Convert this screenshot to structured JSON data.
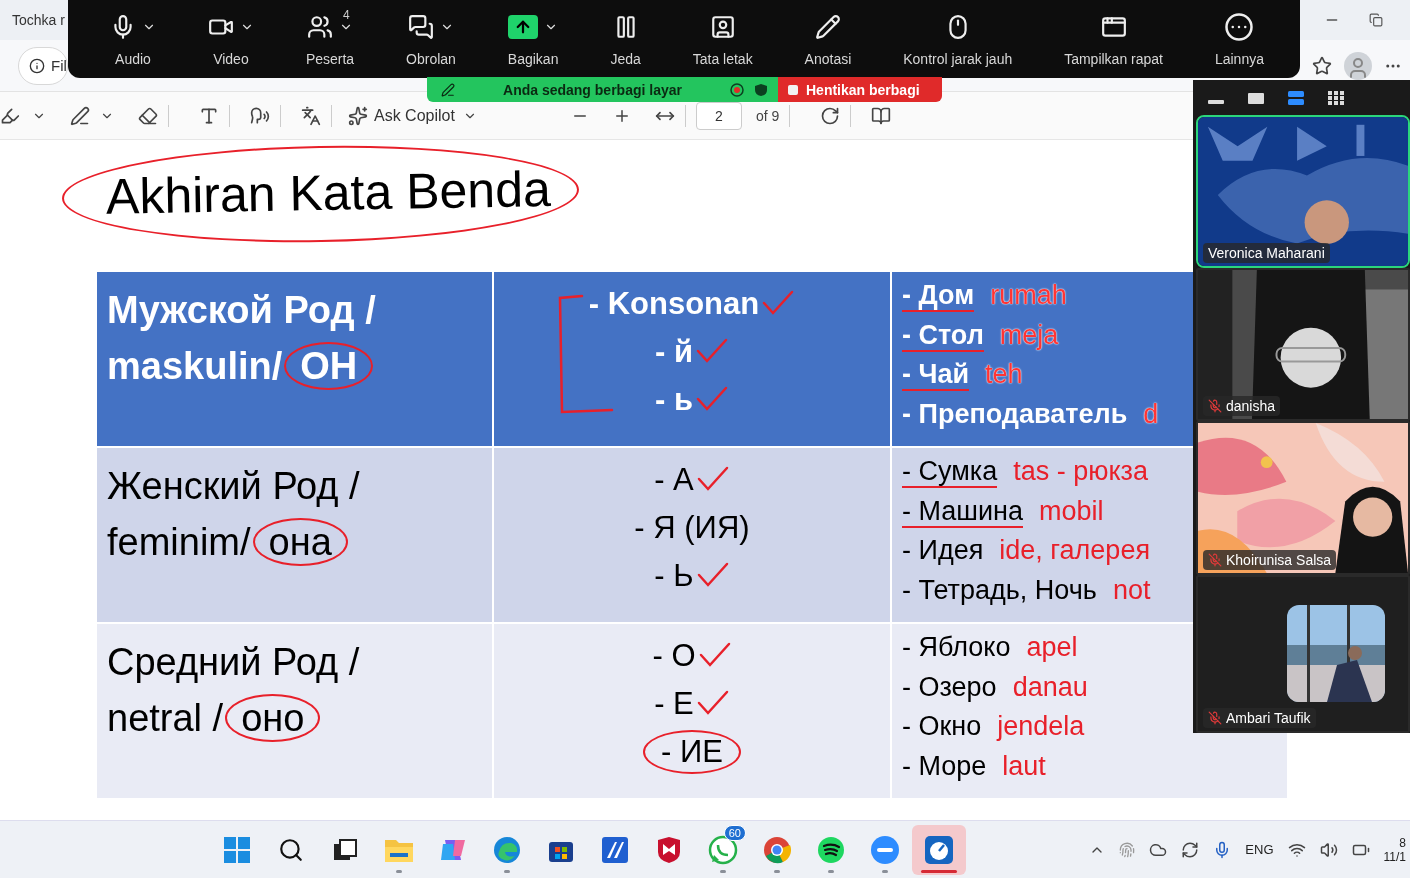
{
  "browser": {
    "tab_title": "Tochka r",
    "address_text": "Fil"
  },
  "zoom_toolbar": {
    "participant_count": "4",
    "items": [
      {
        "label": "Audio",
        "caret": true
      },
      {
        "label": "Video",
        "caret": true
      },
      {
        "label": "Peserta",
        "caret": true
      },
      {
        "label": "Obrolan",
        "caret": true
      },
      {
        "label": "Bagikan",
        "caret": true
      },
      {
        "label": "Jeda",
        "caret": false
      },
      {
        "label": "Tata letak",
        "caret": false
      },
      {
        "label": "Anotasi",
        "caret": false
      },
      {
        "label": "Kontrol jarak jauh",
        "caret": false
      },
      {
        "label": "Tampilkan rapat",
        "caret": false
      },
      {
        "label": "Lainnya",
        "caret": false
      }
    ]
  },
  "share_banner": {
    "message": "Anda sedang berbagi layar",
    "stop_label": "Hentikan berbagi"
  },
  "pdf_toolbar": {
    "copilot_label": "Ask Copilot",
    "page": "2",
    "page_total": "of 9"
  },
  "slide": {
    "title": "Akhiran Kata Benda",
    "rows": [
      {
        "header": true,
        "gender": "Мужской Род /",
        "gender_label": "maskulin/",
        "pronoun": "ОН",
        "bracketed": true,
        "endings": [
          {
            "text": "- Konsonan",
            "ticked": true,
            "circled": false
          },
          {
            "text": "- й",
            "ticked": true,
            "circled": false
          },
          {
            "text": "- ь",
            "ticked": true,
            "circled": false
          }
        ],
        "words": [
          {
            "word": "- Дом",
            "underlined": true,
            "note": "rumah"
          },
          {
            "word": "- Стол",
            "underlined": true,
            "note": "meja"
          },
          {
            "word": "- Чай",
            "underlined": true,
            "note": "teh"
          },
          {
            "word": "- Преподаватель",
            "underlined": false,
            "note": "d"
          }
        ]
      },
      {
        "header": false,
        "gender": "Женский Род /",
        "gender_label": "feminim/",
        "pronoun": "она",
        "bracketed": false,
        "endings": [
          {
            "text": "- А",
            "ticked": true,
            "circled": false
          },
          {
            "text": "- Я (ИЯ)",
            "ticked": false,
            "circled": false
          },
          {
            "text": "- Ь",
            "ticked": true,
            "circled": false
          }
        ],
        "words": [
          {
            "word": "- Сумка",
            "underlined": true,
            "note": "tas - рюкза"
          },
          {
            "word": "- Машина",
            "underlined": true,
            "note": "mobil"
          },
          {
            "word": "- Идея",
            "underlined": false,
            "note": "ide, галерея"
          },
          {
            "word": "- Тетрадь, Ночь",
            "underlined": false,
            "note": "not"
          }
        ]
      },
      {
        "header": false,
        "gender": "Средний Род /",
        "gender_label": "netral /",
        "pronoun": "оно",
        "bracketed": false,
        "endings": [
          {
            "text": "- О",
            "ticked": true,
            "circled": false
          },
          {
            "text": "- Е",
            "ticked": true,
            "circled": false
          },
          {
            "text": "- ИЕ",
            "ticked": false,
            "circled": true
          }
        ],
        "words": [
          {
            "word": "- Яблоко",
            "underlined": false,
            "note": "apel"
          },
          {
            "word": "- Озеро",
            "underlined": false,
            "note": "danau"
          },
          {
            "word": "- Окно",
            "underlined": false,
            "note": "jendela"
          },
          {
            "word": "- Море",
            "underlined": false,
            "note": "laut"
          }
        ]
      }
    ]
  },
  "participants": {
    "view_modes": [
      {
        "selected": false
      },
      {
        "selected": false
      },
      {
        "selected": true
      },
      {
        "selected": false
      }
    ],
    "tiles": [
      {
        "name": "Veronica Maharani",
        "active_speaker": true,
        "muted": false
      },
      {
        "name": "danisha",
        "active_speaker": false,
        "muted": true
      },
      {
        "name": "Khoirunisa Salsa",
        "active_speaker": false,
        "muted": true
      },
      {
        "name": "Ambari Taufik",
        "active_speaker": false,
        "muted": true
      }
    ]
  },
  "taskbar": {
    "apps": [
      {
        "active": false,
        "running": false
      },
      {
        "active": false,
        "running": false
      },
      {
        "active": false,
        "running": false
      },
      {
        "active": false,
        "running": true
      },
      {
        "active": false,
        "running": false
      },
      {
        "active": false,
        "running": true
      },
      {
        "active": false,
        "running": false
      },
      {
        "active": false,
        "running": false
      },
      {
        "active": false,
        "running": false
      },
      {
        "active": false,
        "running": true,
        "badge": "60"
      },
      {
        "active": false,
        "running": true
      },
      {
        "active": false,
        "running": true
      },
      {
        "active": false,
        "running": true
      },
      {
        "active": true,
        "running": true
      }
    ],
    "language": "ENG",
    "time": "8",
    "date": "11/1"
  }
}
